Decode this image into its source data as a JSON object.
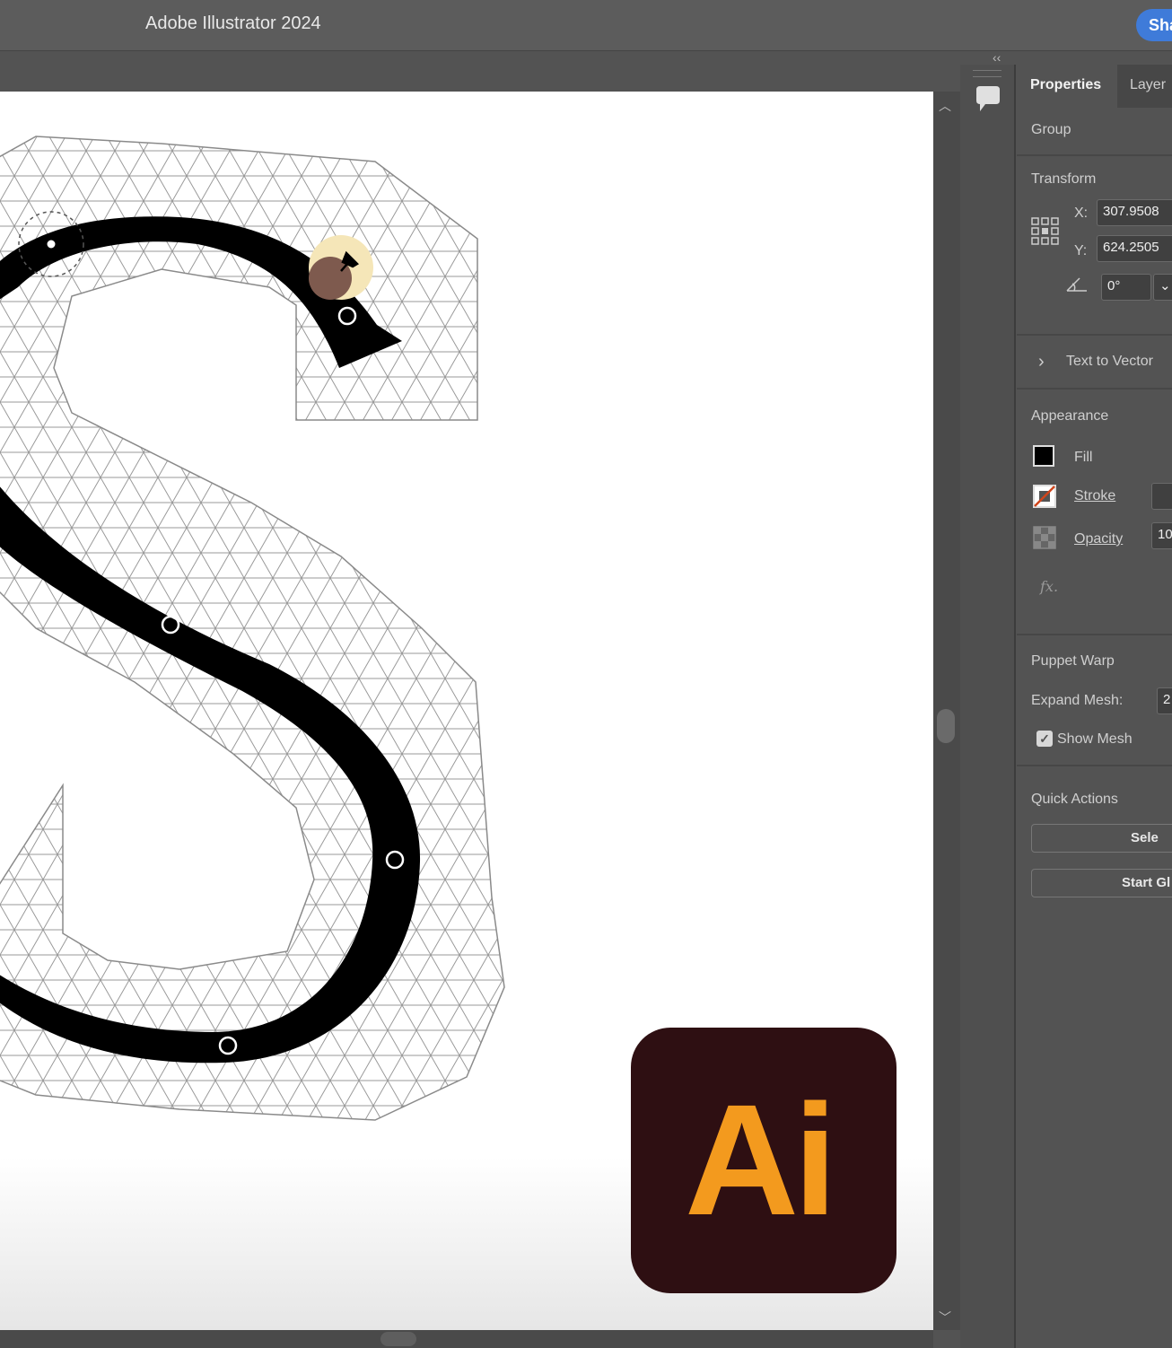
{
  "app": {
    "title": "Adobe Illustrator 2024",
    "share_label": "Sha"
  },
  "panel": {
    "tabs": [
      "Properties",
      "Layer"
    ],
    "selection_type": "Group",
    "transform": {
      "title": "Transform",
      "x_label": "X:",
      "x_value": "307.9508",
      "y_label": "Y:",
      "y_value": "624.2505",
      "angle_value": "0°"
    },
    "text_to_vector": "Text to Vector",
    "appearance": {
      "title": "Appearance",
      "fill": "Fill",
      "stroke": "Stroke",
      "opacity": "Opacity",
      "opacity_value": "10",
      "fx": "fx."
    },
    "puppet_warp": {
      "title": "Puppet Warp",
      "expand_mesh_label": "Expand Mesh:",
      "expand_mesh_value": "2",
      "show_mesh_label": "Show Mesh",
      "show_mesh_checked": true
    },
    "quick_actions": {
      "title": "Quick Actions",
      "button1": "Sele",
      "button2": "Start Gl"
    }
  },
  "logo": {
    "text": "Ai",
    "bg_color": "#2e0f12",
    "fg_color": "#f39a1e"
  },
  "colors": {
    "accent_blue": "#3f7bd9",
    "ui_gray": "#535353"
  }
}
